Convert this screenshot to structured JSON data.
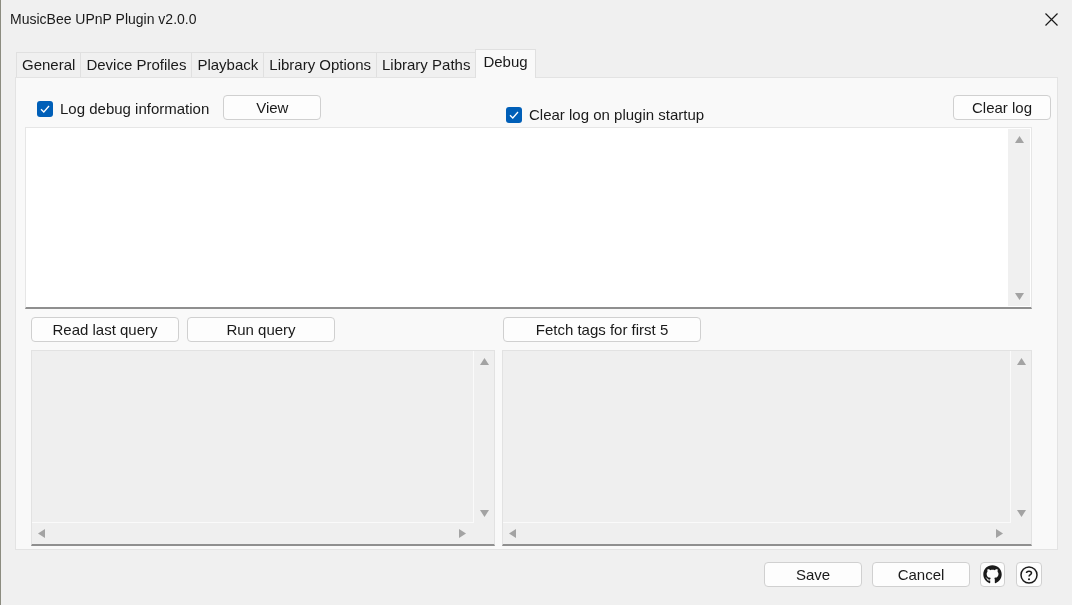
{
  "window": {
    "title": "MusicBee UPnP Plugin v2.0.0"
  },
  "tabs": [
    {
      "label": "General",
      "selected": false
    },
    {
      "label": "Device Profiles",
      "selected": false
    },
    {
      "label": "Playback",
      "selected": false
    },
    {
      "label": "Library Options",
      "selected": false
    },
    {
      "label": "Library Paths",
      "selected": false
    },
    {
      "label": "Debug",
      "selected": true
    }
  ],
  "debug": {
    "log_debug": {
      "label": "Log debug information",
      "checked": true
    },
    "view_button": "View",
    "clear_on_startup": {
      "label": "Clear log on plugin startup",
      "checked": true
    },
    "clear_log_button": "Clear log"
  },
  "query": {
    "left_buttons": [
      "Read last query",
      "Run query"
    ],
    "right_buttons": [
      "Fetch tags for first 5"
    ]
  },
  "footer": {
    "buttons": [
      "Save",
      "Cancel"
    ]
  }
}
